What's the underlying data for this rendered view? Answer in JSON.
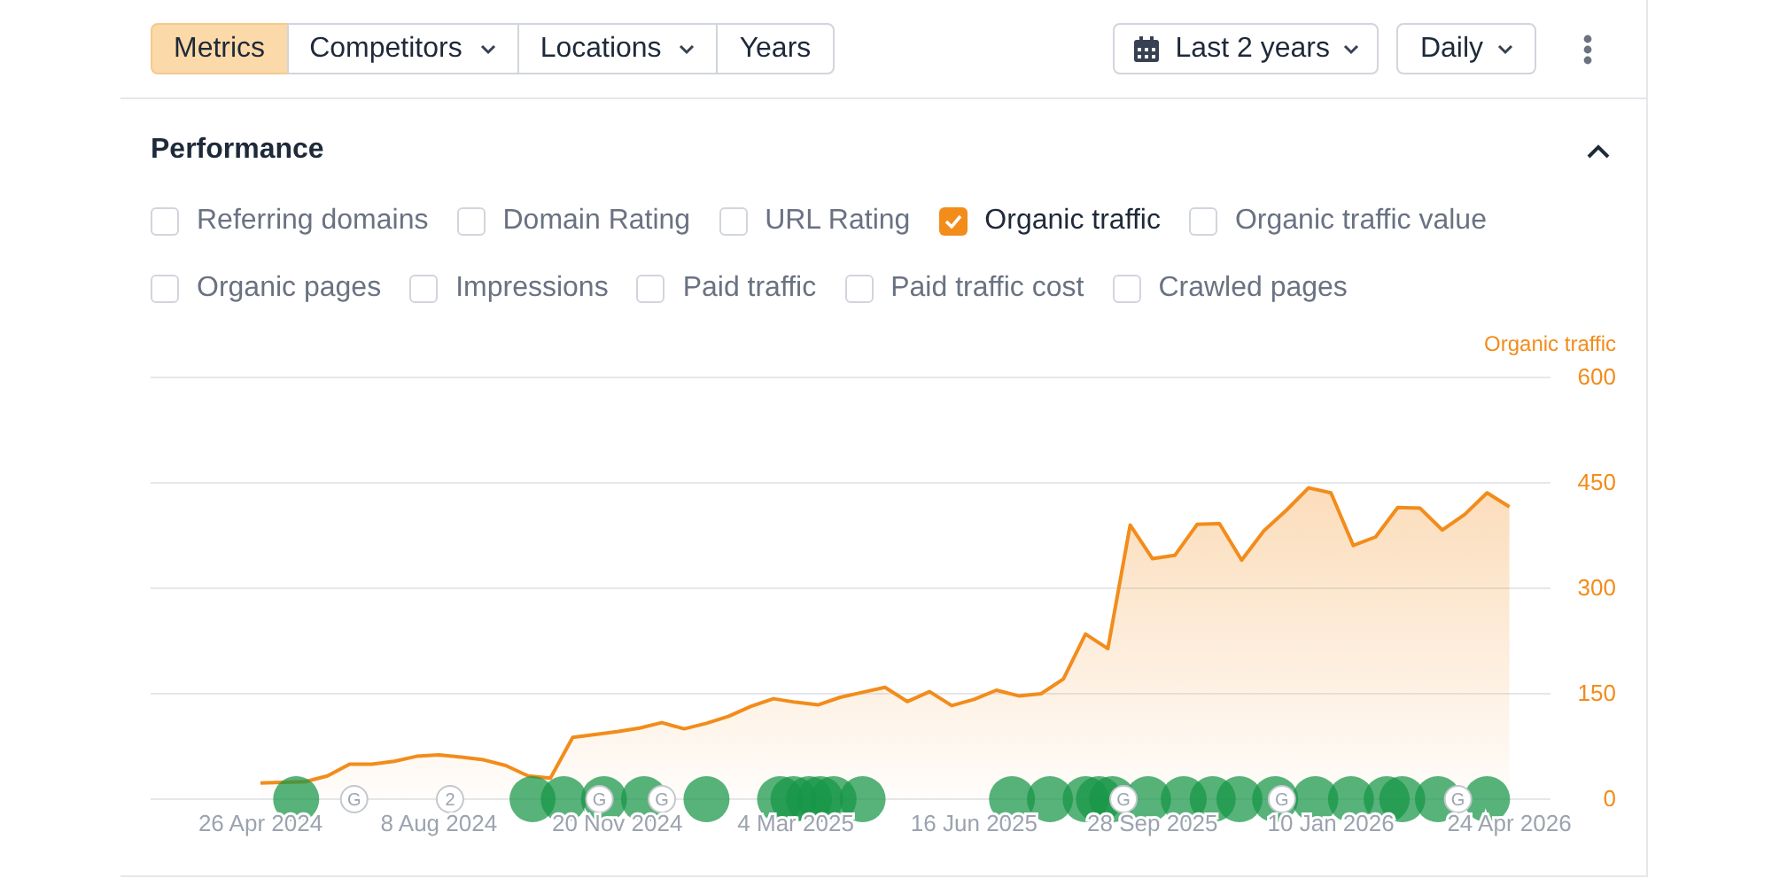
{
  "toolbar": {
    "tabs": [
      {
        "label": "Metrics",
        "selected": true,
        "dropdown": false
      },
      {
        "label": "Competitors",
        "selected": false,
        "dropdown": true
      },
      {
        "label": "Locations",
        "selected": false,
        "dropdown": true
      },
      {
        "label": "Years",
        "selected": false,
        "dropdown": false
      }
    ],
    "period": "Last 2 years",
    "interval": "Daily"
  },
  "section": {
    "title": "Performance",
    "expanded": true,
    "metric_rows": [
      [
        {
          "label": "Referring domains",
          "checked": false
        },
        {
          "label": "Domain Rating",
          "checked": false
        },
        {
          "label": "URL Rating",
          "checked": false
        },
        {
          "label": "Organic traffic",
          "checked": true
        },
        {
          "label": "Organic traffic value",
          "checked": false
        }
      ],
      [
        {
          "label": "Organic pages",
          "checked": false
        },
        {
          "label": "Impressions",
          "checked": false
        },
        {
          "label": "Paid traffic",
          "checked": false
        },
        {
          "label": "Paid traffic cost",
          "checked": false
        },
        {
          "label": "Crawled pages",
          "checked": false
        }
      ]
    ],
    "chart_data": {
      "type": "area",
      "grid": true,
      "ylim": [
        0,
        600
      ],
      "yticks": [
        0,
        150,
        300,
        450,
        600
      ],
      "categories": [
        "26 Apr 2024",
        null,
        null,
        null,
        null,
        null,
        null,
        null,
        "8 Aug 2024",
        null,
        null,
        null,
        null,
        null,
        null,
        null,
        "20 Nov 2024",
        null,
        null,
        null,
        null,
        null,
        null,
        null,
        "4 Mar 2025",
        null,
        null,
        null,
        null,
        null,
        null,
        null,
        "16 Jun 2025",
        null,
        null,
        null,
        null,
        null,
        null,
        null,
        "28 Sep 2025",
        null,
        null,
        null,
        null,
        null,
        null,
        null,
        "10 Jan 2026",
        null,
        null,
        null,
        null,
        null,
        null,
        null,
        "24 Apr 2026"
      ],
      "series": [
        {
          "name": "Organic traffic",
          "color": "#f28c1b",
          "values": [
            23,
            24,
            25,
            33,
            50,
            50,
            54,
            61,
            63,
            60,
            56,
            48,
            33,
            30,
            88,
            92,
            96,
            101,
            109,
            100,
            108,
            118,
            132,
            143,
            138,
            134,
            145,
            152,
            159,
            139,
            153,
            133,
            142,
            155,
            147,
            150,
            171,
            235,
            214,
            390,
            342,
            347,
            391,
            392,
            340,
            382,
            411,
            443,
            436,
            361,
            373,
            415,
            414,
            383,
            405,
            436,
            416
          ]
        }
      ]
    },
    "markers": [
      {
        "kind": "event"
      },
      {
        "kind": "event"
      },
      {
        "kind": "event"
      },
      {
        "kind": "event"
      },
      {
        "kind": "event"
      },
      {
        "kind": "event"
      },
      {
        "kind": "event"
      },
      {
        "kind": "event"
      },
      {
        "kind": "event"
      },
      {
        "kind": "event"
      },
      {
        "kind": "event"
      },
      {
        "kind": "event"
      },
      {
        "kind": "event"
      },
      {
        "kind": "event"
      },
      {
        "kind": "event"
      },
      {
        "kind": "event"
      },
      {
        "kind": "event"
      },
      {
        "kind": "event"
      },
      {
        "kind": "event"
      },
      {
        "kind": "event"
      },
      {
        "kind": "event"
      },
      {
        "kind": "event"
      },
      {
        "kind": "event"
      },
      {
        "kind": "event"
      },
      {
        "kind": "event"
      },
      {
        "kind": "event"
      },
      {
        "kind": "event"
      },
      {
        "kind": "event"
      },
      {
        "kind": "update",
        "text": "G"
      },
      {
        "kind": "update",
        "text": "2"
      },
      {
        "kind": "update",
        "text": "G"
      },
      {
        "kind": "update",
        "text": "G"
      },
      {
        "kind": "update",
        "text": "G"
      },
      {
        "kind": "update",
        "text": "G"
      },
      {
        "kind": "update",
        "text": "G"
      }
    ]
  }
}
